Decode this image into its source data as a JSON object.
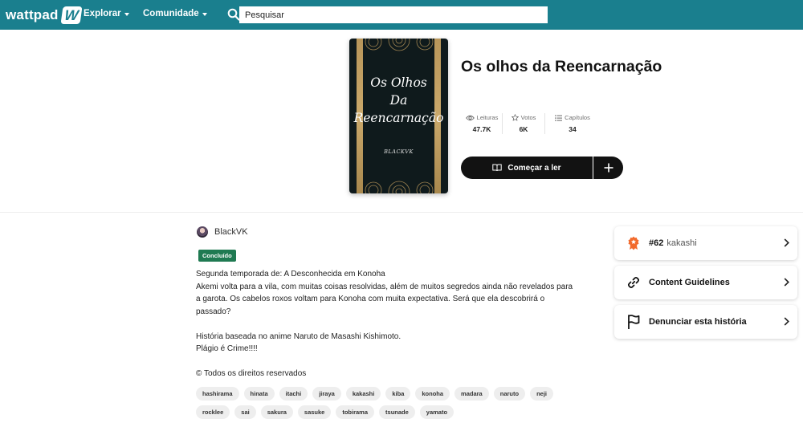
{
  "header": {
    "logo_text": "wattpad",
    "logo_glyph": "W",
    "nav": [
      {
        "label": "Explorar"
      },
      {
        "label": "Comunidade"
      }
    ],
    "search_placeholder": "Pesquisar",
    "brand_color": "#1a7f8e"
  },
  "story": {
    "cover_title_lines": [
      "Os Olhos",
      "Da",
      "Reencarnação"
    ],
    "cover_author": "BLACKVK",
    "title": "Os olhos da Reencarnação",
    "stats": [
      {
        "label": "Leituras",
        "value": "47.7K",
        "icon": "eye-icon"
      },
      {
        "label": "Votos",
        "value": "6K",
        "icon": "star-icon"
      },
      {
        "label": "Capítulos",
        "value": "34",
        "icon": "list-icon"
      }
    ],
    "start_label": "Começar a ler"
  },
  "author": {
    "name": "BlackVK"
  },
  "status_badge": "Concluído",
  "status_color": "#1f7a52",
  "description": {
    "p1": "Segunda temporada de: A Desconhecida em Konoha\nAkemi volta para a vila, com muitas coisas resolvidas, além de muitos segredos ainda não revelados para a garota. Os cabelos roxos voltam para Konoha com muita expectativa. Será que ela descobrirá o passado?",
    "p2": "História baseada no anime Naruto de Masashi Kishimoto.\nPlágio é Crime!!!!",
    "p3": "© Todos os direitos reservados"
  },
  "tags": [
    "hashirama",
    "hinata",
    "itachi",
    "jiraya",
    "kakashi",
    "kiba",
    "konoha",
    "madara",
    "naruto",
    "neji",
    "rocklee",
    "sai",
    "sakura",
    "sasuke",
    "tobirama",
    "tsunade",
    "yamato"
  ],
  "cards": {
    "ranking": {
      "rank": "#62",
      "tag": "kakashi"
    },
    "guidelines": "Content Guidelines",
    "report": "Denunciar esta história"
  }
}
